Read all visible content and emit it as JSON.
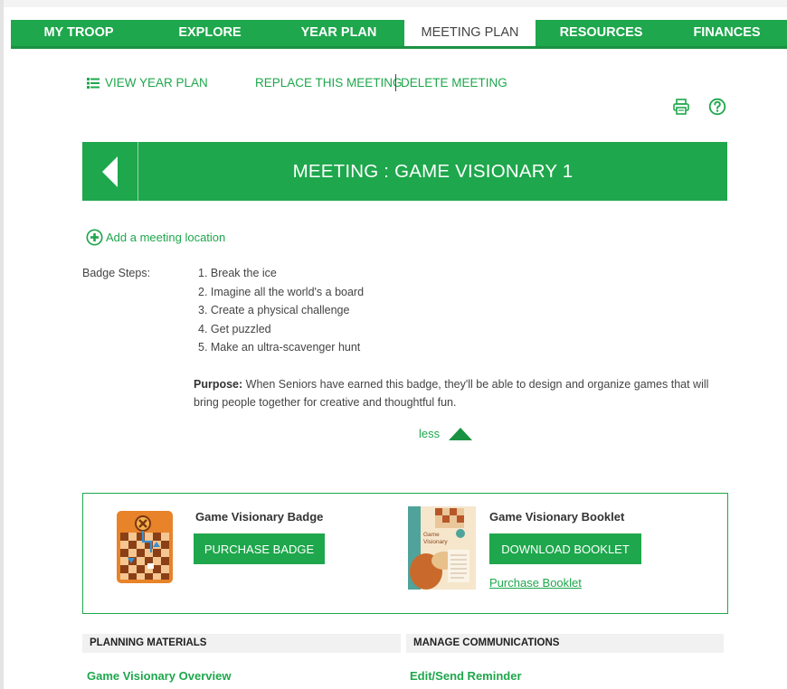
{
  "nav": {
    "items": [
      {
        "label": "MY TROOP",
        "active": false
      },
      {
        "label": "EXPLORE",
        "active": false
      },
      {
        "label": "YEAR PLAN",
        "active": false
      },
      {
        "label": "MEETING PLAN",
        "active": true
      },
      {
        "label": "RESOURCES",
        "active": false
      },
      {
        "label": "FINANCES",
        "active": false
      }
    ]
  },
  "actions": {
    "view_year_plan": "VIEW YEAR PLAN",
    "replace_meeting": "REPLACE THIS MEETING",
    "delete_meeting": "DELETE MEETING"
  },
  "meeting": {
    "title": "MEETING : GAME VISIONARY 1",
    "add_location": "Add a meeting location"
  },
  "badge_steps": {
    "label": "Badge Steps:",
    "steps": [
      "1. Break the ice",
      "2. Imagine all the world's a board",
      "3. Create a physical challenge",
      "4. Get puzzled",
      "5. Make an ultra-scavenger hunt"
    ]
  },
  "purpose": {
    "label": "Purpose:",
    "text": "When Seniors have earned this badge, they'll be able to design and organize games that will bring people together for creative and thoughtful fun."
  },
  "toggle": {
    "less_label": "less"
  },
  "badge": {
    "title": "Game Visionary Badge",
    "button": "PURCHASE BADGE"
  },
  "booklet": {
    "title": "Game Visionary Booklet",
    "button": "DOWNLOAD BOOKLET",
    "purchase_link": "Purchase Booklet",
    "cover_text": "Game Visionary"
  },
  "planning": {
    "header": "PLANNING MATERIALS",
    "link": "Game Visionary Overview"
  },
  "communications": {
    "header": "MANAGE COMMUNICATIONS",
    "link": "Edit/Send Reminder"
  },
  "colors": {
    "brand_green": "#1ea74c",
    "text_dark": "#333333",
    "badge_orange": "#e8832a"
  },
  "icons": {
    "list": "list-icon",
    "print": "printer-icon",
    "help": "help-icon",
    "back": "back-arrow-icon",
    "add": "plus-circle-icon",
    "collapse": "triangle-up-icon"
  }
}
